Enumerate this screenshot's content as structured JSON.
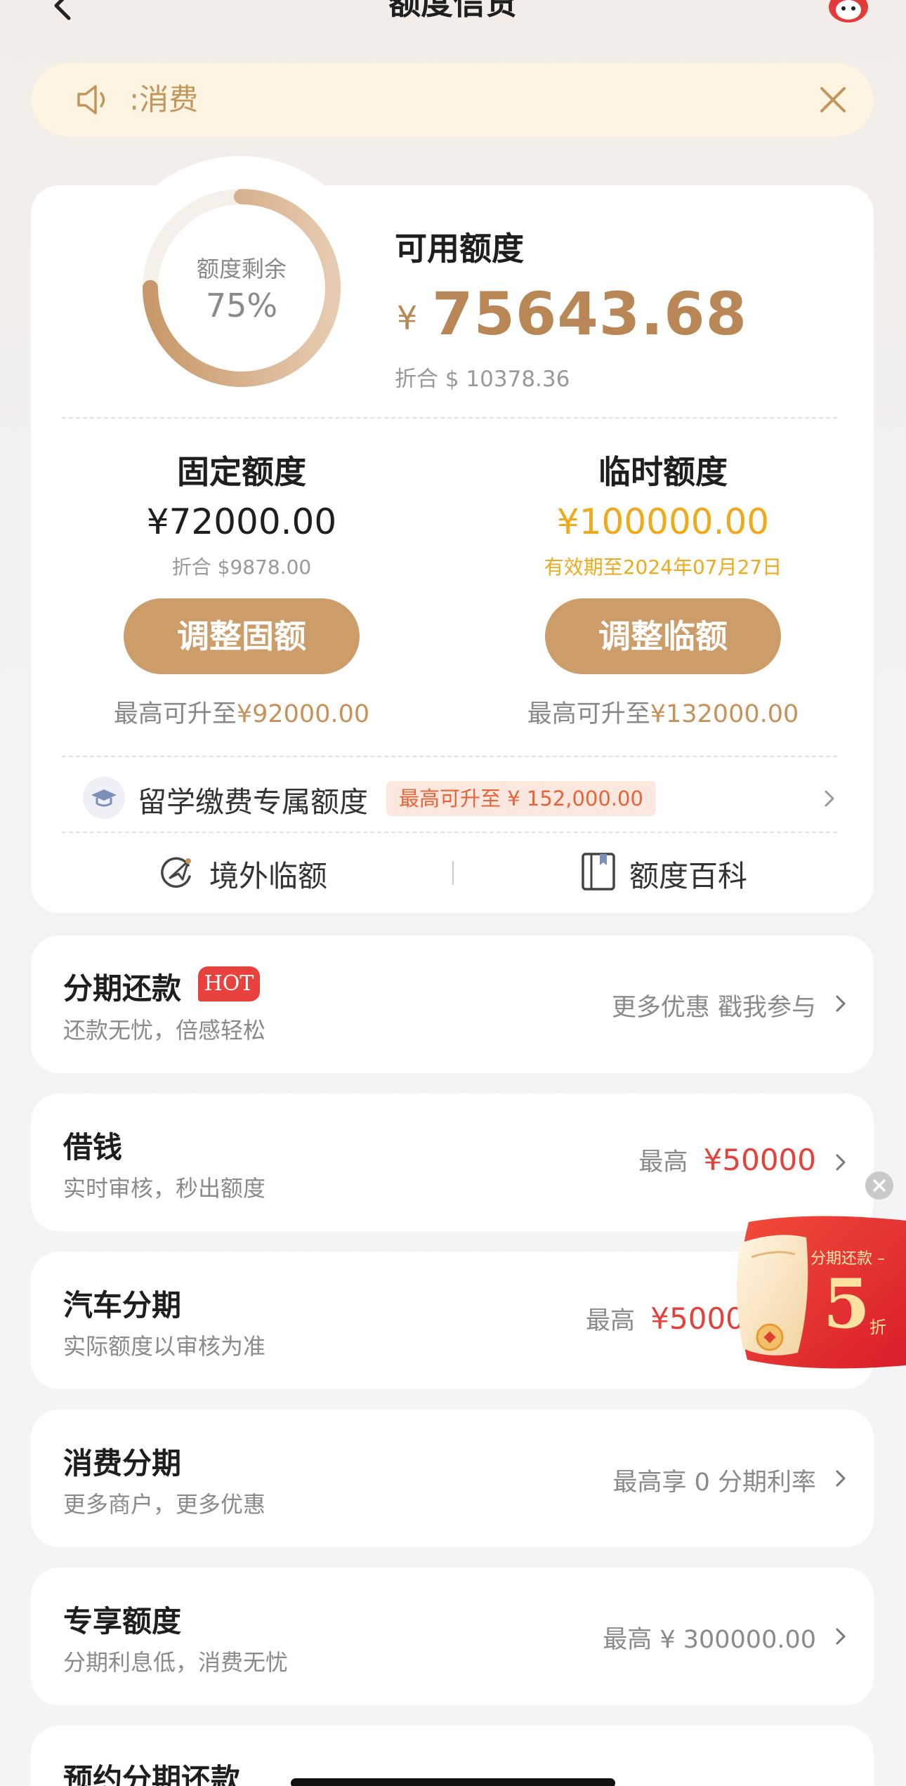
{
  "header": {
    "title": "额度信贷"
  },
  "notice": {
    "text": ":消费"
  },
  "quota": {
    "remaining_label": "额度剩余",
    "remaining_percent_text": "75%",
    "remaining_fraction": 0.75,
    "available_title": "可用额度",
    "currency_symbol": "¥",
    "available_amount": "75643.68",
    "available_converted": "折合 $ 10378.36",
    "fixed": {
      "title": "固定额度",
      "amount": "¥72000.00",
      "converted": "折合 $9878.00",
      "button": "调整固额",
      "max_prefix": "最高可升至",
      "max_value": "¥92000.00"
    },
    "temp": {
      "title": "临时额度",
      "amount": "¥100000.00",
      "validity": "有效期至2024年07月27日",
      "button": "调整临额",
      "max_prefix": "最高可升至",
      "max_value": "¥132000.00"
    },
    "study": {
      "label": "留学缴费专属额度",
      "badge": "最高可升至 ¥ 152,000.00"
    },
    "links": {
      "overseas": "境外临额",
      "wiki": "额度百科"
    }
  },
  "services": [
    {
      "title": "分期还款",
      "badge": "HOT",
      "subtitle": "还款无忧，倍感轻松",
      "right": "更多优惠 戳我参与"
    },
    {
      "title": "借钱",
      "subtitle": "实时审核，秒出额度",
      "right_prefix": "最高",
      "right_value": "¥50000"
    },
    {
      "title": "汽车分期",
      "subtitle": "实际额度以审核为准",
      "right_prefix": "最高",
      "right_value": "¥5000"
    },
    {
      "title": "消费分期",
      "subtitle": "更多商户，更多优惠",
      "right": "最高享 0 分期利率"
    },
    {
      "title": "专享额度",
      "subtitle": "分期利息低，消费无忧",
      "right": "最高 ¥ 300000.00"
    },
    {
      "title": "预约分期还款",
      "subtitle": "",
      "right": ""
    }
  ],
  "promo": {
    "top_text": "– 分期还款 –",
    "number": "5",
    "unit": "折"
  },
  "colors": {
    "accent_gold": "#c7915a",
    "button_gold": "#cc9c69",
    "temp_yellow": "#eeaa1a",
    "red": "#e5403a"
  }
}
